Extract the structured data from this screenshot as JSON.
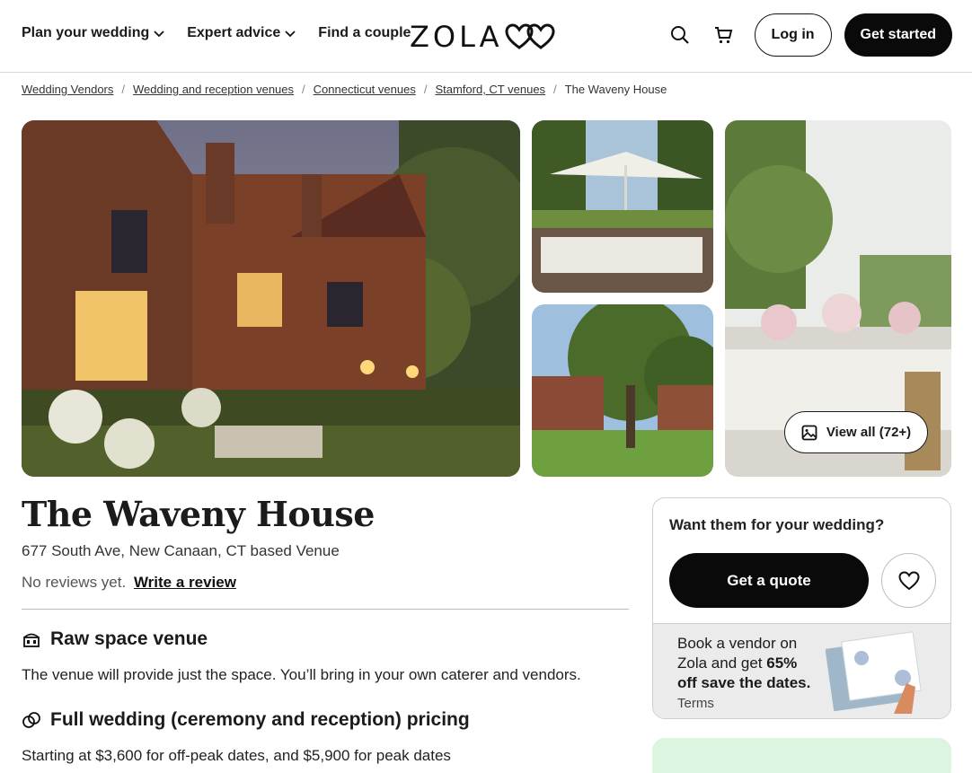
{
  "header": {
    "nav": [
      {
        "label": "Plan your wedding",
        "has_dropdown": true
      },
      {
        "label": "Expert advice",
        "has_dropdown": true
      },
      {
        "label": "Find a couple",
        "has_dropdown": false
      }
    ],
    "logo_text": "ZOLA",
    "login_label": "Log in",
    "get_started_label": "Get started",
    "icons": [
      "search-icon",
      "cart-icon"
    ]
  },
  "breadcrumb": {
    "links": [
      "Wedding Vendors",
      "Wedding and reception venues",
      "Connecticut venues",
      "Stamford, CT venues"
    ],
    "current": "The Waveny House",
    "separator": "/"
  },
  "gallery": {
    "view_all_label": "View all (72+)"
  },
  "venue": {
    "name": "The Waveny House",
    "address": "677 South Ave, New Canaan, CT based Venue",
    "reviews_text": "No reviews yet.",
    "write_review_label": "Write a review"
  },
  "features": [
    {
      "icon": "venue-icon",
      "title": "Raw space venue",
      "text": "The venue will provide just the space. You’ll bring in your own caterer and vendors."
    },
    {
      "icon": "rings-icon",
      "title": "Full wedding (ceremony and reception) pricing",
      "text": "Starting at $3,600 for off-peak dates, and $5,900 for peak dates"
    }
  ],
  "quote_card": {
    "question": "Want them for your wedding?",
    "quote_button": "Get a quote",
    "promo_prefix": "Book a vendor on Zola and get ",
    "promo_bold": "65% off save the dates.",
    "promo_terms": "Terms"
  },
  "colors": {
    "primary": "#0a0a0a",
    "promo_bg": "#ebebeb",
    "green_card": "#dcf5e1"
  }
}
